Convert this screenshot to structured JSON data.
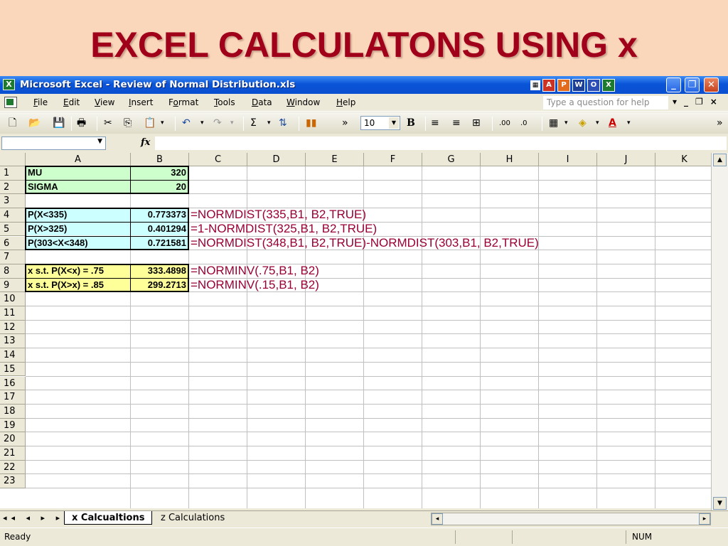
{
  "slide": {
    "title": "EXCEL CALCULATONS USING x"
  },
  "window": {
    "title": "Microsoft Excel - Review of Normal Distribution.xls",
    "app_icon": "excel-icon",
    "minimize": "_",
    "restore": "❐",
    "close": "✕"
  },
  "menu": {
    "items": [
      "File",
      "Edit",
      "View",
      "Insert",
      "Format",
      "Tools",
      "Data",
      "Window",
      "Help"
    ],
    "underline": [
      "F",
      "E",
      "V",
      "I",
      "o",
      "T",
      "D",
      "W",
      "H"
    ],
    "ask_placeholder": "Type a question for help",
    "ctrl_dropdown": "▾",
    "ctrl_min": "_",
    "ctrl_restore": "❐",
    "ctrl_close": "×"
  },
  "toolbar": {
    "font_size": "10",
    "more": "»",
    "sum": "Σ",
    "bold": "B"
  },
  "formula_bar": {
    "fx": "fx",
    "name": "",
    "formula": ""
  },
  "grid": {
    "columns": [
      "A",
      "B",
      "C",
      "D",
      "E",
      "F",
      "G",
      "H",
      "I",
      "J",
      "K"
    ],
    "rows": [
      "1",
      "2",
      "3",
      "4",
      "5",
      "6",
      "7",
      "8",
      "9",
      "10",
      "11",
      "12",
      "13",
      "14",
      "15",
      "16",
      "17",
      "18",
      "19",
      "20",
      "21",
      "22",
      "23"
    ],
    "cells": {
      "A1": "MU",
      "B1": "320",
      "A2": "SIGMA",
      "B2": "20",
      "A4": "P(X<335)",
      "B4": "0.773373",
      "A5": "P(X>325)",
      "B5": "0.401294",
      "A6": "P(303<X<348)",
      "B6": "0.721581",
      "A8": "x s.t. P(X<x) = .75",
      "B8": "333.4898",
      "A9": "x s.t. P(X>x) = .85",
      "B9": "299.2713"
    },
    "notes": {
      "r4": "=NORMDIST(335,B1, B2,TRUE)",
      "r5": "=1-NORMDIST(325,B1, B2,TRUE)",
      "r6": "=NORMDIST(348,B1, B2,TRUE)-NORMDIST(303,B1, B2,TRUE)",
      "r8": "=NORMINV(.75,B1, B2)",
      "r9": "=NORMINV(.15,B1, B2)"
    }
  },
  "sheets": {
    "active": "x Calcualtions",
    "other": "z Calculations",
    "nav": "◂◂ ◂ ▸ ▸▸"
  },
  "status": {
    "ready": "Ready",
    "num": "NUM"
  },
  "colors": {
    "slide_bg": "#fad7ba",
    "title": "#a0001a",
    "formula_note": "#990033",
    "green_fill": "#ccffcc",
    "cyan_fill": "#ccffff",
    "yellow_fill": "#ffff99"
  }
}
